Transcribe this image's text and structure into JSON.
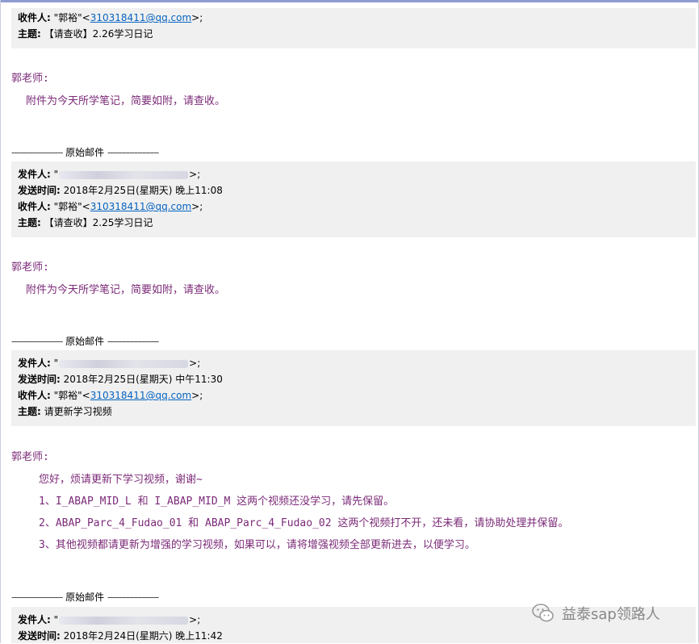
{
  "labels": {
    "from": "发件人:",
    "sent": "发送时间:",
    "to": "收件人:",
    "subject": "主题:"
  },
  "separator": "原始邮件",
  "salutation": "郭老师:",
  "emails": [
    {
      "to_name": "\"郭裕\"<",
      "to_email": "310318411@qq.com",
      "to_tail": ">;",
      "subject": "【请查收】2.26学习日记",
      "body": [
        "附件为今天所学笔记，简要如附，请查收。"
      ]
    },
    {
      "from_tail": ">;",
      "sent": "2018年2月25日(星期天) 晚上11:08",
      "to_name": "\"郭裕\"<",
      "to_email": "310318411@qq.com",
      "to_tail": ">;",
      "subject": "【请查收】2.25学习日记",
      "body": [
        "附件为今天所学笔记，简要如附，请查收。"
      ]
    },
    {
      "from_tail": ">;",
      "sent": "2018年2月25日(星期天) 中午11:30",
      "to_name": "\"郭裕\"<",
      "to_email": "310318411@qq.com",
      "to_tail": ">;",
      "subject": "请更新学习视频",
      "body": [
        "您好，烦请更新下学习视频，谢谢~",
        "1、I_ABAP_MID_L 和 I_ABAP_MID_M 这两个视频还没学习，请先保留。",
        "2、ABAP_Parc_4_Fudao_01 和 ABAP_Parc_4_Fudao_02 这两个视频打不开，还未看，请协助处理并保留。",
        "3、其他视频都请更新为增强的学习视频，如果可以，请将增强视频全部更新进去，以便学习。"
      ]
    },
    {
      "from_tail": ">;",
      "sent": "2018年2月24日(星期六) 晚上11:42"
    }
  ],
  "watermark": {
    "text": "益泰sap领路人",
    "icon": "wechat-icon"
  },
  "colors": {
    "header_bg": "#f0f0f0",
    "body_text": "#7b2a78",
    "link": "#0563c1"
  }
}
